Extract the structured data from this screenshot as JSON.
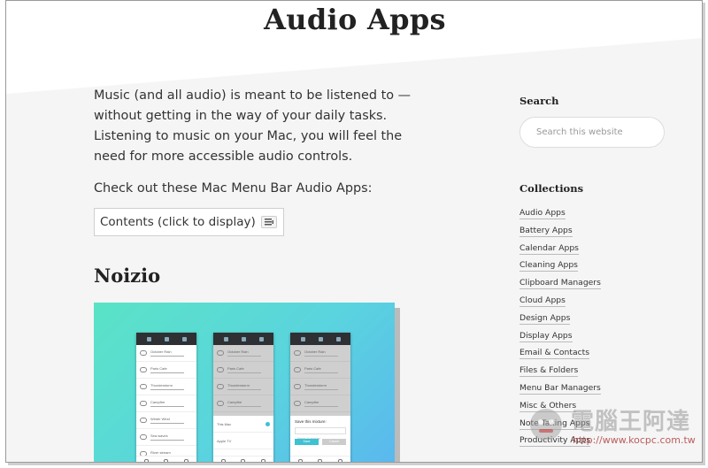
{
  "page": {
    "title": "Audio Apps",
    "intro": "Music (and all audio) is meant to be listened to — without getting in the way of your daily tasks. Listening to music on your Mac, you will feel the need for more accessible audio controls.",
    "lead": "Check out these Mac Menu Bar Audio Apps:",
    "toc_label": "Contents (click to display)",
    "section_title": "Noizio"
  },
  "screenshot": {
    "phone1_rows": [
      "October Rain",
      "Paris Cafe",
      "Thunderstorm",
      "Campfire",
      "Winter Wind",
      "Sea waves",
      "River stream"
    ],
    "phone2_rows": [
      "October Rain",
      "Paris Cafe",
      "Thunderstorm",
      "Campfire"
    ],
    "phone2_devices": [
      "This Mac",
      "Apple TV",
      "Speakers"
    ],
    "phone3_rows": [
      "October Rain",
      "Paris Cafe",
      "Thunderstorm",
      "Campfire"
    ],
    "phone3_dialog_title": "Save this mixture:",
    "phone3_dialog_placeholder": "Name of mixture",
    "phone3_save": "Save",
    "phone3_cancel": "Cancel"
  },
  "sidebar": {
    "search_heading": "Search",
    "search_placeholder": "Search this website",
    "collections_heading": "Collections",
    "collections": [
      "Audio Apps",
      "Battery Apps",
      "Calendar Apps",
      "Cleaning Apps",
      "Clipboard Managers",
      "Cloud Apps",
      "Design Apps",
      "Display Apps",
      "Email & Contacts",
      "Files & Folders",
      "Menu Bar Managers",
      "Misc & Others",
      "Note Taking Apps",
      "Productivity Apps"
    ]
  },
  "watermark": {
    "text": "電腦王阿達",
    "url": "http://www.kocpc.com.tw"
  },
  "colors": {
    "accent_teal": "#5ae3c6",
    "accent_blue": "#5ab8ee",
    "dialog_button": "#3dc1d3"
  }
}
